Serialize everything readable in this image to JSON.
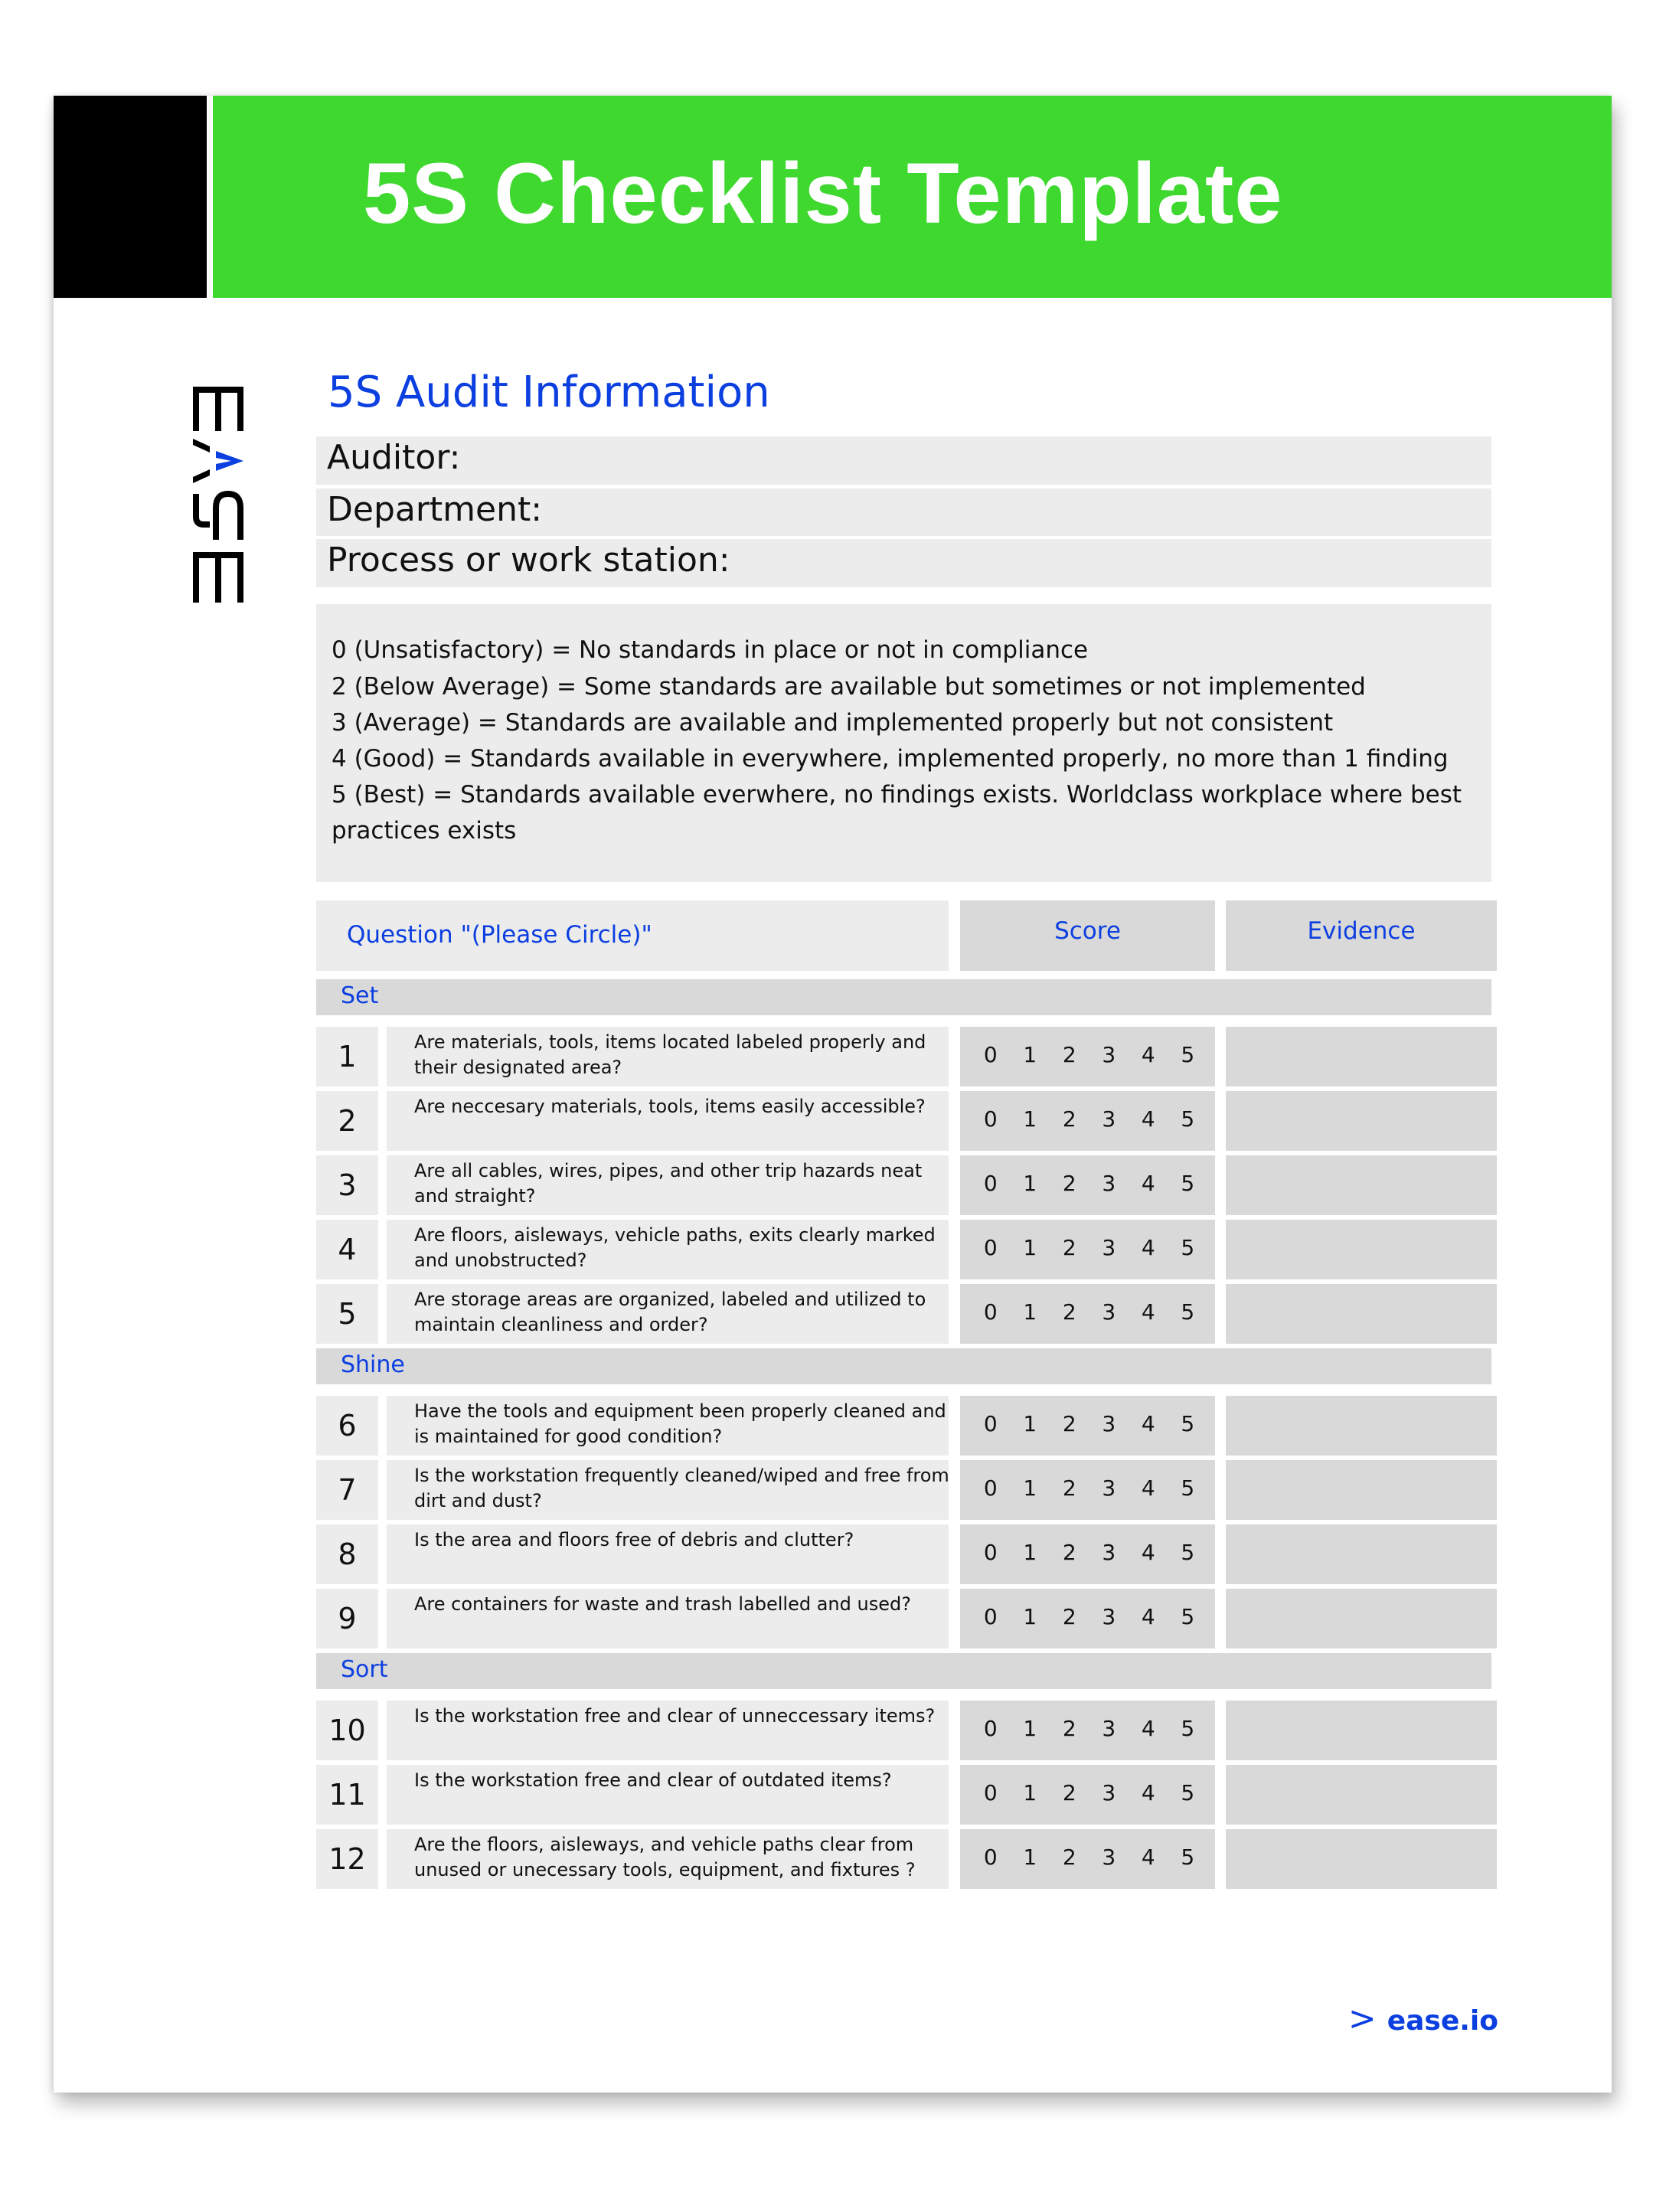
{
  "header": {
    "title": "5S Checklist Template"
  },
  "brand": {
    "logo_icon": "ease-logo-icon",
    "accent": "#0c3fe0",
    "header_green": "#3ed82f"
  },
  "audit_info": {
    "title": "5S Audit Information",
    "fields": [
      {
        "label": "Auditor:",
        "value": ""
      },
      {
        "label": "Department:",
        "value": ""
      },
      {
        "label": "Process or work station:",
        "value": ""
      }
    ]
  },
  "legend": [
    "0 (Unsatisfactory) = No standards in place or not in compliance",
    "2 (Below Average) = Some standards are available but sometimes or not implemented",
    "3 (Average) = Standards are available and implemented properly but not consistent",
    "4 (Good) = Standards available in everywhere, implemented properly, no more than 1 finding",
    "5 (Best) = Standards available everwhere, no findings exists.  Worldclass workplace where best",
    "practices exists"
  ],
  "table": {
    "headers": {
      "question": "Question \"(Please Circle)\"",
      "score": "Score",
      "evidence": "Evidence"
    },
    "score_options": [
      "0",
      "1",
      "2",
      "3",
      "4",
      "5"
    ],
    "sections": [
      {
        "name": "Set",
        "rows": [
          {
            "num": "1",
            "question": "Are materials, tools, items located labeled properly and their designated area?",
            "evidence": ""
          },
          {
            "num": "2",
            "question": "Are neccesary materials, tools, items easily accessible?",
            "evidence": ""
          },
          {
            "num": "3",
            "question": "Are all cables, wires, pipes, and other trip hazards neat and straight?",
            "evidence": ""
          },
          {
            "num": "4",
            "question": "Are floors, aisleways, vehicle paths, exits clearly marked and unobstructed?",
            "evidence": ""
          },
          {
            "num": "5",
            "question": "Are storage areas are organized, labeled and utilized to maintain cleanliness and order?",
            "evidence": ""
          }
        ]
      },
      {
        "name": "Shine",
        "rows": [
          {
            "num": "6",
            "question": "Have the tools and equipment been properly cleaned and is maintained for good condition?",
            "evidence": ""
          },
          {
            "num": "7",
            "question": "Is the workstation frequently cleaned/wiped and free from dirt and dust?",
            "evidence": ""
          },
          {
            "num": "8",
            "question": "Is the area and floors free of debris and clutter?",
            "evidence": ""
          },
          {
            "num": "9",
            "question": "Are containers for waste and trash labelled and used?",
            "evidence": ""
          }
        ]
      },
      {
        "name": "Sort",
        "rows": [
          {
            "num": "10",
            "question": "Is the workstation free and clear of unneccessary items?",
            "evidence": ""
          },
          {
            "num": "11",
            "question": "Is the workstation free and clear of outdated items?",
            "evidence": ""
          },
          {
            "num": "12",
            "question": "Are the floors, aisleways, and vehicle paths clear from unused or unecessary tools, equipment, and fixtures ?",
            "evidence": ""
          }
        ]
      }
    ]
  },
  "footer": {
    "chevron_icon": "chevron-right-icon",
    "site": "ease.io"
  }
}
